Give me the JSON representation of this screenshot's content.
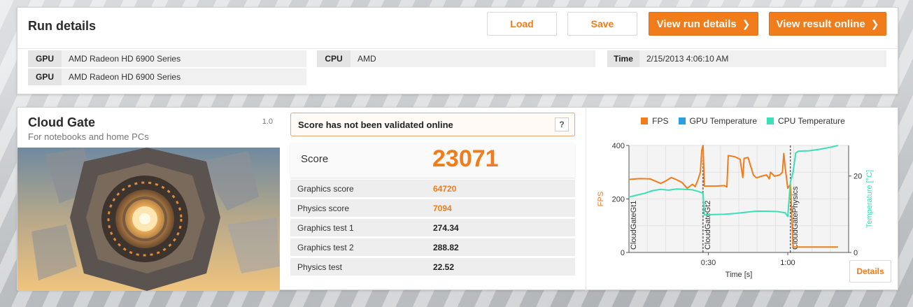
{
  "run": {
    "title": "Run details",
    "buttons": {
      "load": "Load",
      "save": "Save",
      "view_run": "View run details",
      "view_online": "View result online"
    },
    "gpu1": {
      "key": "GPU",
      "value": "AMD Radeon HD 6900 Series"
    },
    "gpu2": {
      "key": "GPU",
      "value": "AMD Radeon HD 6900 Series"
    },
    "cpu": {
      "key": "CPU",
      "value": "AMD"
    },
    "time": {
      "key": "Time",
      "value": "2/15/2013 4:06:10 AM"
    }
  },
  "test": {
    "name": "Cloud Gate",
    "subtitle": "For notebooks and home PCs",
    "version": "1.0"
  },
  "score": {
    "validation": "Score has not been validated online",
    "help": "?",
    "label": "Score",
    "value": "23071",
    "rows": [
      {
        "label": "Graphics score",
        "value": "64720",
        "accent": true
      },
      {
        "label": "Physics score",
        "value": "7094",
        "accent": true
      },
      {
        "label": "Graphics test 1",
        "value": "274.34",
        "accent": false
      },
      {
        "label": "Graphics test 2",
        "value": "288.82",
        "accent": false
      },
      {
        "label": "Physics test",
        "value": "22.52",
        "accent": false
      }
    ]
  },
  "colors": {
    "accent": "#f07c1c",
    "fps": "#f07c1c",
    "gpu_temp": "#2a9ee0",
    "cpu_temp": "#3ae0b8"
  },
  "chart_data": {
    "type": "line",
    "legend": [
      "FPS",
      "GPU Temperature",
      "CPU Temperature"
    ],
    "legend_position": "top-center",
    "xlabel": "Time [s]",
    "ylabel_left": "FPS",
    "ylabel_right": "Temperature [°C]",
    "x_ticks": [
      "0:30",
      "1:00"
    ],
    "y_left_ticks": [
      "0",
      "200",
      "400"
    ],
    "y_right_ticks": [
      "0",
      "20"
    ],
    "xlim": [
      0,
      83
    ],
    "ylim_left": [
      0,
      400
    ],
    "ylim_right": [
      0,
      28
    ],
    "segments": [
      {
        "label": "CloudGateGt1",
        "x": 0
      },
      {
        "label": "CloudGateGt2",
        "x": 28
      },
      {
        "label": "CloudGatePhysics",
        "x": 61
      }
    ],
    "series": [
      {
        "name": "FPS",
        "x": [
          0,
          4,
          8,
          12,
          14,
          16,
          18,
          20,
          22,
          24,
          25,
          26,
          27,
          27.5,
          28,
          28.5,
          30,
          33,
          36,
          37,
          37.5,
          40,
          42,
          43,
          43.5,
          45,
          47,
          48,
          48.5,
          50,
          52,
          53,
          53.5,
          55,
          57,
          58,
          58.5,
          59,
          60,
          61,
          62,
          64,
          68,
          72,
          76,
          79
        ],
        "y": [
          273,
          276,
          275,
          258,
          268,
          280,
          272,
          262,
          240,
          255,
          246,
          270,
          300,
          382,
          400,
          248,
          248,
          248,
          250,
          245,
          362,
          358,
          348,
          280,
          352,
          355,
          290,
          280,
          280,
          285,
          290,
          275,
          300,
          285,
          290,
          300,
          370,
          320,
          240,
          255,
          20,
          20,
          20,
          20,
          20,
          20
        ]
      },
      {
        "name": "GPU Temperature",
        "x": [],
        "y": []
      },
      {
        "name": "CPU Temperature",
        "x": [
          0,
          3,
          6,
          9,
          12,
          15,
          18,
          21,
          24,
          26,
          28,
          28.5,
          31,
          36,
          40,
          44,
          48,
          52,
          56,
          59,
          60,
          61,
          62,
          63,
          64,
          68,
          72,
          76,
          79
        ],
        "y": [
          14.5,
          15,
          15.5,
          16.2,
          16.5,
          16.3,
          16.6,
          16.5,
          16.4,
          16.0,
          15.5,
          9.8,
          9.9,
          10.0,
          10.2,
          10.5,
          10.8,
          10.8,
          10.7,
          10.4,
          9.4,
          18.5,
          21,
          26,
          26.5,
          26.6,
          27,
          27.5,
          28
        ]
      }
    ]
  }
}
